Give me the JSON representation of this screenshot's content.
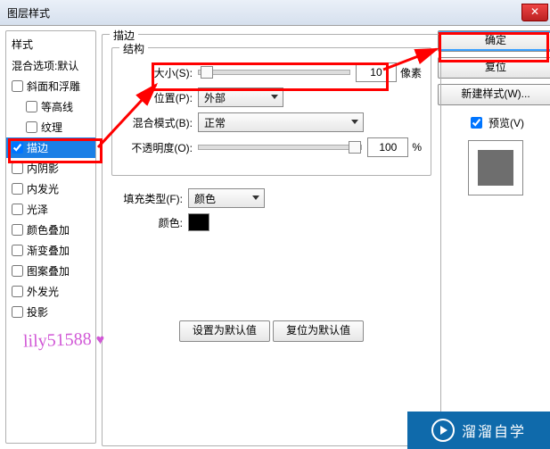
{
  "window": {
    "title": "图层样式"
  },
  "left": {
    "heading": "样式",
    "blend_default": "混合选项:默认",
    "items": [
      {
        "label": "斜面和浮雕",
        "checked": false,
        "indent": false
      },
      {
        "label": "等高线",
        "checked": false,
        "indent": true
      },
      {
        "label": "纹理",
        "checked": false,
        "indent": true
      },
      {
        "label": "描边",
        "checked": true,
        "indent": false,
        "selected": true
      },
      {
        "label": "内阴影",
        "checked": false,
        "indent": false
      },
      {
        "label": "内发光",
        "checked": false,
        "indent": false
      },
      {
        "label": "光泽",
        "checked": false,
        "indent": false
      },
      {
        "label": "颜色叠加",
        "checked": false,
        "indent": false
      },
      {
        "label": "渐变叠加",
        "checked": false,
        "indent": false
      },
      {
        "label": "图案叠加",
        "checked": false,
        "indent": false
      },
      {
        "label": "外发光",
        "checked": false,
        "indent": false
      },
      {
        "label": "投影",
        "checked": false,
        "indent": false
      }
    ]
  },
  "mid": {
    "stroke_title": "描边",
    "structure_title": "结构",
    "size_label": "大小(S):",
    "size_value": "10",
    "size_unit": "像素",
    "position_label": "位置(P):",
    "position_value": "外部",
    "blendmode_label": "混合模式(B):",
    "blendmode_value": "正常",
    "opacity_label": "不透明度(O):",
    "opacity_value": "100",
    "opacity_unit": "%",
    "filltype_label": "填充类型(F):",
    "filltype_value": "颜色",
    "color_label": "颜色:",
    "set_default": "设置为默认值",
    "reset_default": "复位为默认值"
  },
  "right": {
    "ok": "确定",
    "reset": "复位",
    "new_style": "新建样式(W)...",
    "preview_label": "预览(V)"
  },
  "watermark": "lily51588",
  "logo_text": "溜溜自学",
  "icons": {
    "close": "✕"
  }
}
